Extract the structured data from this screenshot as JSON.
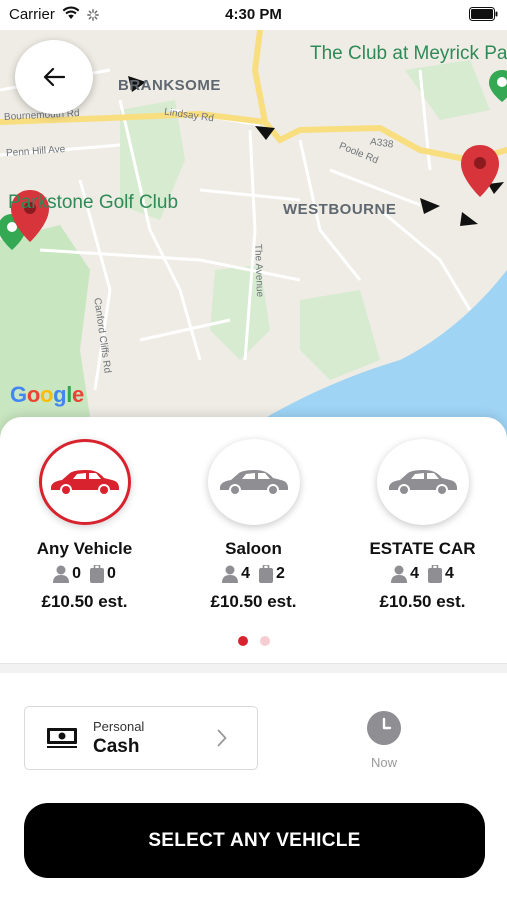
{
  "status_bar": {
    "carrier": "Carrier",
    "time": "4:30 PM",
    "icons": [
      "wifi-icon",
      "activity-spinner-icon",
      "battery-icon"
    ]
  },
  "map": {
    "area_labels": [
      "BRANKSOME",
      "WESTBOURNE"
    ],
    "poi_labels": [
      "The Club at Meyrick Pa",
      "Parkstone Golf Club"
    ],
    "road_labels": [
      "Bournemouth Rd",
      "Lindsay Rd",
      "Penn Hill Ave",
      "A338",
      "Poole Rd",
      "The Avenue",
      "Canford Cliffs Rd"
    ],
    "provider_logo": "Google",
    "colors": {
      "land": "#eeece4",
      "road": "#ffffff",
      "main_road": "#f9de80",
      "park": "#c8e6c0",
      "water": "#9fd4f5",
      "marker": "#d8343c"
    }
  },
  "back_button": {
    "icon": "arrow-left-icon"
  },
  "vehicles": [
    {
      "name": "Any Vehicle",
      "passengers": "0",
      "luggage": "0",
      "price": "£10.50 est.",
      "selected": true
    },
    {
      "name": "Saloon",
      "passengers": "4",
      "luggage": "2",
      "price": "£10.50 est.",
      "selected": false
    },
    {
      "name": "ESTATE CAR",
      "passengers": "4",
      "luggage": "4",
      "price": "£10.50 est.",
      "selected": false
    }
  ],
  "pagination": {
    "page": 1,
    "total": 2
  },
  "payment": {
    "type": "Personal",
    "method": "Cash",
    "icon": "cash-icon"
  },
  "pickup_time": {
    "label": "Now",
    "icon": "clock-icon"
  },
  "action": {
    "label": "SELECT ANY VEHICLE"
  },
  "colors": {
    "accent": "#d8232f",
    "car_inactive": "#8e8e93",
    "button": "#000000"
  }
}
